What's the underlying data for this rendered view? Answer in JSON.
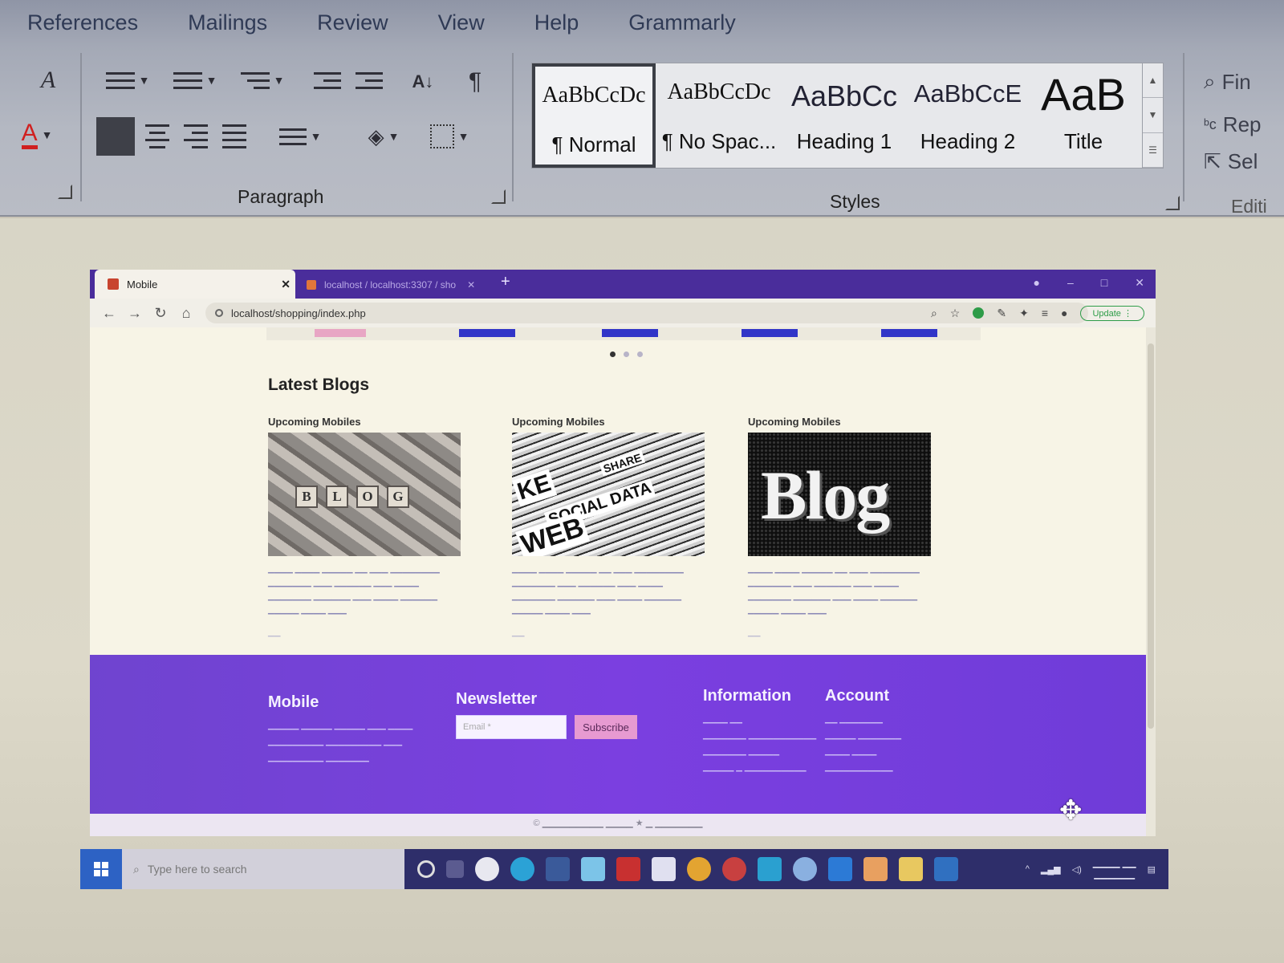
{
  "ribbon": {
    "tabs": [
      "References",
      "Mailings",
      "Review",
      "View",
      "Help",
      "Grammarly"
    ],
    "groups": {
      "paragraph": "Paragraph",
      "styles": "Styles",
      "editing": "Editi"
    },
    "styles": [
      {
        "preview": "AaBbCcDc",
        "name": "¶ Normal",
        "selected": true
      },
      {
        "preview": "AaBbCcDc",
        "name": "¶ No Spac...",
        "selected": false
      },
      {
        "preview": "AaBbCc",
        "name": "Heading 1",
        "selected": false
      },
      {
        "preview": "AaBbCcE",
        "name": "Heading 2",
        "selected": false
      },
      {
        "preview": "AaB",
        "name": "Title",
        "selected": false
      }
    ],
    "editing": [
      "Fin",
      "Rep",
      "Sel"
    ]
  },
  "browser": {
    "active_tab": "Mobile",
    "other_tab": "localhost / localhost:3307 / sho",
    "url": "localhost/shopping/index.php",
    "update_label": "Update"
  },
  "site": {
    "section_title": "Latest Blogs",
    "blogs": [
      {
        "category": "Upcoming Mobiles",
        "image": "blog-scrabble-tiles",
        "letters": [
          "B",
          "L",
          "O",
          "G"
        ]
      },
      {
        "category": "Upcoming Mobiles",
        "image": "blog-word-cloud",
        "words": [
          "KE",
          "SOCIAL DATA",
          "WEB",
          "SHARE"
        ]
      },
      {
        "category": "Upcoming Mobiles",
        "image": "blog-letterpress",
        "word": "Blog"
      }
    ],
    "footer": {
      "brand": "Mobile",
      "newsletter_title": "Newsletter",
      "email_placeholder": "Email *",
      "subscribe_label": "Subscribe",
      "information_title": "Information",
      "account_title": "Account"
    }
  },
  "taskbar": {
    "search_placeholder": "Type here to search"
  },
  "colors": {
    "footer_purple": "#7b3fe0",
    "browser_tab_bar": "#4a2d9b",
    "subscribe_pink": "#e79ad1",
    "carousel_button_blue": "#3135c8"
  }
}
